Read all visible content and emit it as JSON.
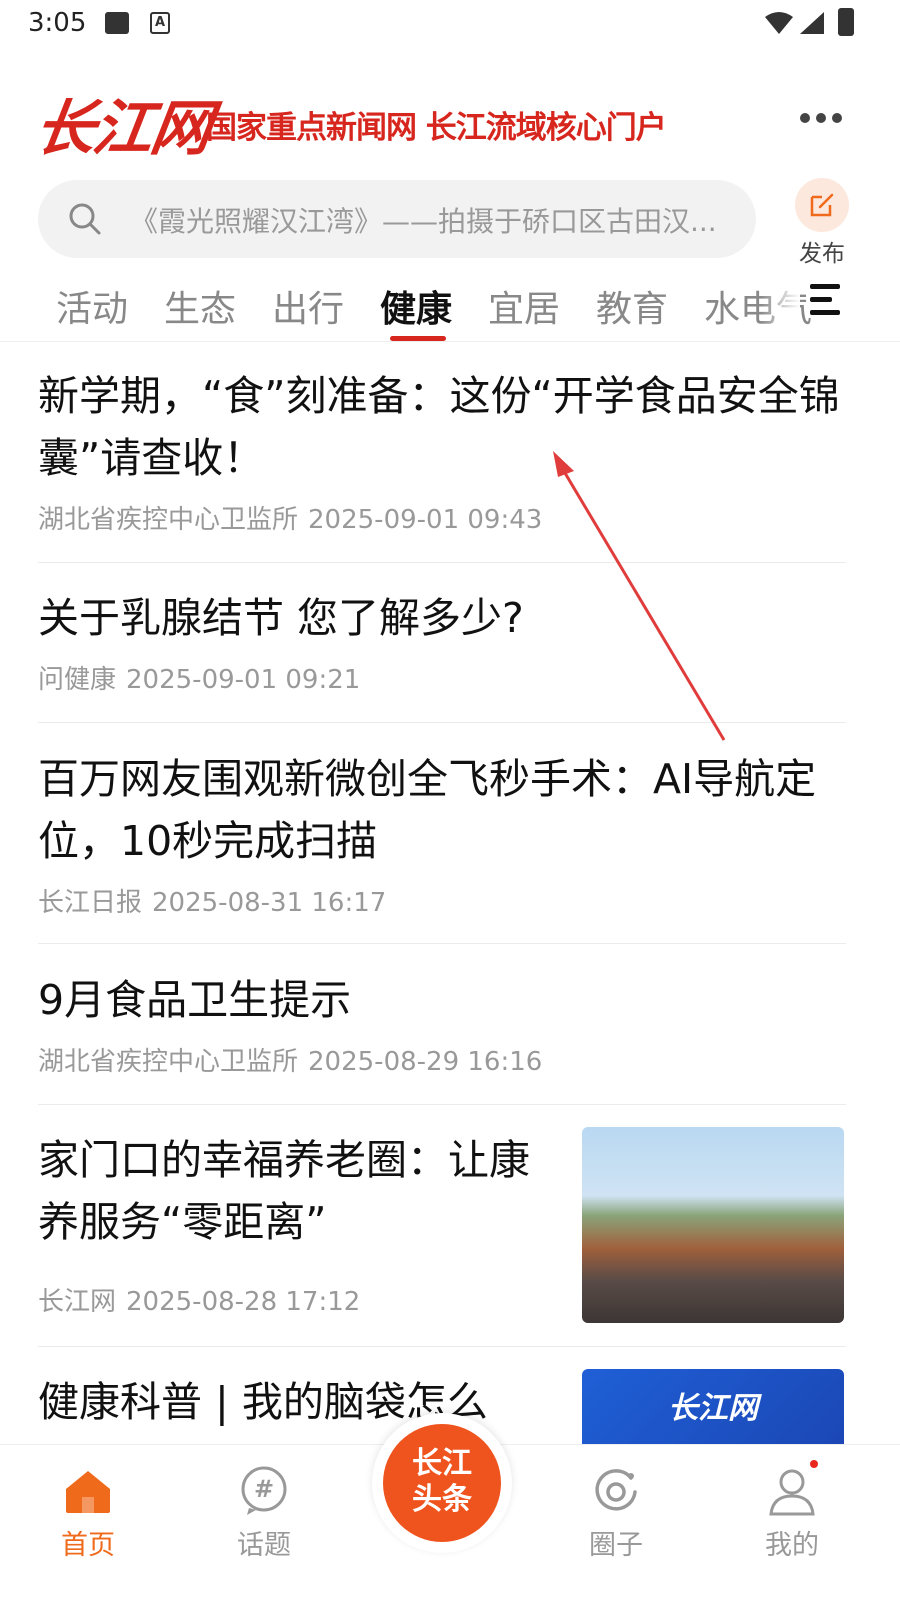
{
  "status_bar": {
    "time": "3:05"
  },
  "brand": {
    "logo_text": "长江网",
    "slogan": "国家重点新闻网 长江流域核心门户"
  },
  "search": {
    "placeholder": "《霞光照耀汉江湾》——拍摄于硚口区古田汉..."
  },
  "publish": {
    "label": "发布"
  },
  "tabs": [
    {
      "label": "活动"
    },
    {
      "label": "生态"
    },
    {
      "label": "出行"
    },
    {
      "label": "健康",
      "active": true
    },
    {
      "label": "宜居"
    },
    {
      "label": "教育"
    },
    {
      "label": "水电气"
    }
  ],
  "news": [
    {
      "title": "新学期，“食”刻准备：这份“开学食品安全锦囊”请查收！",
      "source": "湖北省疾控中心卫监所",
      "time": "2025-09-01 09:43"
    },
    {
      "title": "关于乳腺结节 您了解多少?",
      "source": "问健康",
      "time": "2025-09-01 09:21"
    },
    {
      "title": "百万网友围观新微创全飞秒手术：AI导航定位，10秒完成扫描",
      "source": "长江日报",
      "time": "2025-08-31 16:17"
    },
    {
      "title": "9月食品卫生提示",
      "source": "湖北省疾控中心卫监所",
      "time": "2025-08-29 16:16"
    },
    {
      "title": "家门口的幸福养老圈：让康养服务“零距离”",
      "source": "长江网",
      "time": "2025-08-28 17:12",
      "thumb": "market-crowd-photo"
    },
    {
      "title": "健康科普 | 我的脑袋怎么",
      "source": "",
      "time": "",
      "thumb": "changjiang-blue-banner"
    }
  ],
  "bottom_nav": {
    "home": "首页",
    "topics": "话题",
    "center_line1": "长江",
    "center_line2": "头条",
    "circle": "圈子",
    "mine": "我的"
  },
  "colors": {
    "brand_red": "#d7261e",
    "accent_orange": "#f06a1c",
    "annotation_arrow": "#e03c3c"
  }
}
